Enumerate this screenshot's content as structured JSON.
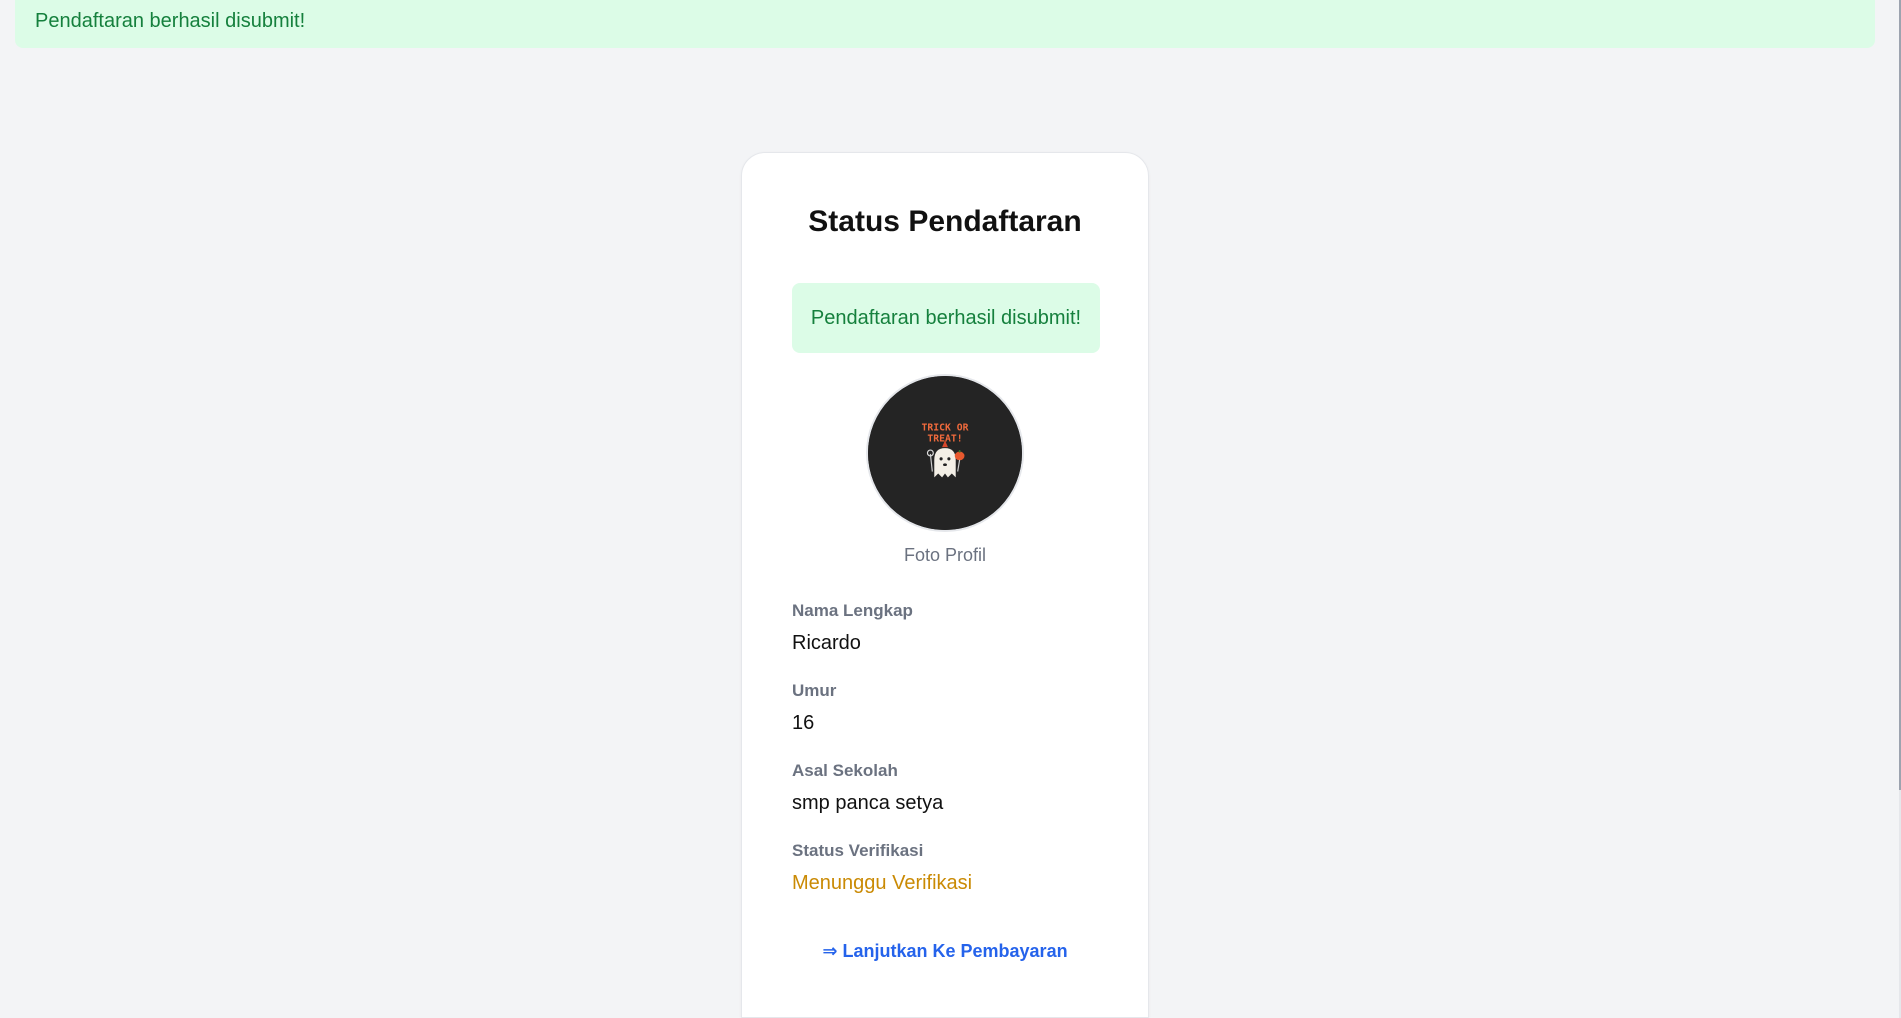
{
  "top_alert": {
    "message": "Pendaftaran berhasil disubmit!"
  },
  "card": {
    "title": "Status Pendaftaran",
    "alert_message": "Pendaftaran berhasil disubmit!",
    "profile_photo": {
      "image_text": "TRICK OR TREAT!",
      "caption": "Foto Profil"
    },
    "fields": [
      {
        "label": "Nama Lengkap",
        "value": "Ricardo"
      },
      {
        "label": "Umur",
        "value": "16"
      },
      {
        "label": "Asal Sekolah",
        "value": "smp panca setya"
      },
      {
        "label": "Status Verifikasi",
        "value": "Menunggu Verifikasi"
      }
    ],
    "payment_link": "⇒ Lanjutkan Ke Pembayaran"
  },
  "colors": {
    "success_bg": "#dcfce7",
    "success_text": "#15803d",
    "pending_text": "#ca8a04",
    "link": "#2563eb",
    "page_bg": "#f3f4f6"
  }
}
